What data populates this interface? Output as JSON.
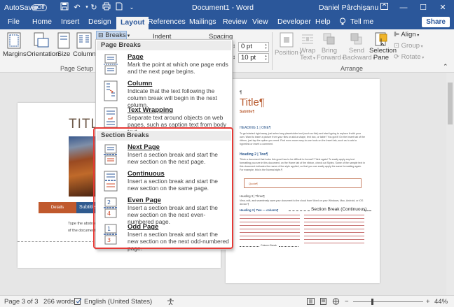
{
  "titlebar": {
    "autosave": "AutoSave",
    "toggle_state": "Off",
    "document_title": "Document1  -  Word",
    "user": "Daniel Pârchișanu",
    "colors": {
      "bar": "#2b579a"
    }
  },
  "tabs": [
    {
      "label": "File"
    },
    {
      "label": "Home"
    },
    {
      "label": "Insert"
    },
    {
      "label": "Design"
    },
    {
      "label": "Layout"
    },
    {
      "label": "References"
    },
    {
      "label": "Mailings"
    },
    {
      "label": "Review"
    },
    {
      "label": "View"
    },
    {
      "label": "Developer"
    },
    {
      "label": "Help"
    }
  ],
  "tell_me": "Tell me",
  "share": "Share",
  "ribbon": {
    "margins": "Margins",
    "orientation": "Orientation",
    "size": "Size",
    "columns": "Columns",
    "breaks": "Breaks",
    "indent": "Indent",
    "spacing": "Spacing",
    "spacing_before": "0 pt",
    "spacing_after": "10 pt",
    "page_setup_label": "Page Setup",
    "position": "Position",
    "wrap_text_1": "Wrap",
    "wrap_text_2": "Text",
    "bring_forward_1": "Bring",
    "bring_forward_2": "Forward",
    "send_backward_1": "Send",
    "send_backward_2": "Backward",
    "selection_pane_1": "Selection",
    "selection_pane_2": "Pane",
    "align": "Align",
    "group": "Group",
    "rotate": "Rotate",
    "arrange_label": "Arrange"
  },
  "breaks_menu": {
    "page_breaks_header": "Page Breaks",
    "section_breaks_header": "Section Breaks",
    "items": [
      {
        "title": "Page",
        "desc": "Mark the point at which one page ends and the next page begins."
      },
      {
        "title": "Column",
        "desc": "Indicate that the text following the column break will begin in the next column."
      },
      {
        "title": "Text Wrapping",
        "desc": "Separate text around objects on web pages, such as caption text from body text."
      },
      {
        "title": "Next Page",
        "desc": "Insert a section break and start the new section on the next page."
      },
      {
        "title": "Continuous",
        "desc": "Insert a section break and start the new section on the same page."
      },
      {
        "title": "Even Page",
        "desc": "Insert a section break and start the new section on the next even-numbered page."
      },
      {
        "title": "Odd Page",
        "desc": "Insert a section break and start the new section on the next odd-numbered page."
      }
    ],
    "highlight_color": "#e53935"
  },
  "document": {
    "left_page": {
      "title": "TITLE",
      "button1": "Details",
      "button2": "Subtitle",
      "body1": "Type the abstract",
      "body2": "of the document. T"
    },
    "right_page": {
      "pilcrow": "¶",
      "title": "Title¶",
      "subtitle": "Subtitle¶",
      "heading1": "HEADING 1 | ONE¶",
      "para1": "To get started right away, just select any placeholder text (such as this) and start typing to replace it with your own. Want to insert a picture from your files or add a shape, text box, or table? You got it! On the Insert tab of the ribbon, just tap the option you need. Find even more easy-to-use tools on the Insert tab, such as to add a hyperlink or insert a comment.",
      "heading2": "Heading 2 | Two¶",
      "para2": "Think a document that looks this good has to be difficult to format? Think again! To easily apply any text formatting you see in this document, on the Home tab of the ribbon, check out Styles. Some of the sample text in this document indicates the name of the style applied, so that you can easily apply the same formatting again. For example, this is the Normal style.¶",
      "quote": "Quote¶",
      "heading3": "Heading 3 | Three¶",
      "para3": "View, edit, and seamlessly save your document to the cloud from Word on your Windows, Mac, Android, or iOS device.¶",
      "heading3b": "Heading 3 | Two — column¶",
      "section_break": "Section Break (Continuous)",
      "column_break": "Column Break"
    }
  },
  "status": {
    "page": "Page 3 of 3",
    "words": "266 words",
    "language": "English (United States)",
    "zoom": "44%",
    "zoom_minus": "−",
    "zoom_plus": "+"
  }
}
